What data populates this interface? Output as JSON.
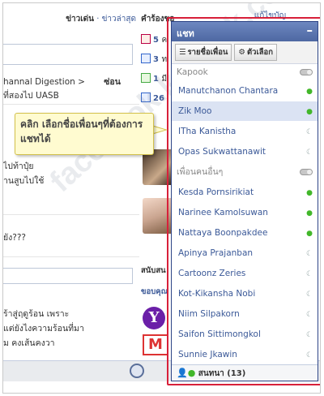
{
  "background": {
    "news_label": "ข่าวเด่น",
    "news_sep": "·",
    "latest_link": "ข่าวล่าสุด",
    "requests_title": "คำร้องขอ",
    "profile_link": "แก้ไขบัญ",
    "line1": "hannal Digestion >",
    "line1_tail": "ซ่อน",
    "line2": "ที่สองไป UASB",
    "line3": "ไปท้าปุ๋ย",
    "line4": "านสูบไปใช้",
    "line5": "ยัง???",
    "line6": "ร้าสู่ฤดูร้อน เพราะ",
    "line7": "แต่ยังไงความร้อนที่มา",
    "line8": "ม คงเส้นคงวา",
    "requests": [
      {
        "count": "5",
        "text": "ค"
      },
      {
        "count": "3",
        "text": "ท"
      },
      {
        "count": "1",
        "text": "มี"
      },
      {
        "count": "26",
        "text": ""
      }
    ],
    "sponsored_label": "สนับสน",
    "thanks_label": "ขอบคุณ"
  },
  "chat": {
    "title": "แชท",
    "minimize": "–",
    "tabs": [
      {
        "icon": "☰",
        "label": "รายชื่อเพื่อน"
      },
      {
        "icon": "⚙",
        "label": "ตัวเลือก"
      }
    ],
    "groups": [
      {
        "name": "Kapook",
        "friends": [
          {
            "name": "Manutchanon Chantara",
            "status": "online"
          },
          {
            "name": "Zik Moo",
            "status": "online",
            "selected": true
          },
          {
            "name": "ITha Kanistha",
            "status": "idle"
          },
          {
            "name": "Opas Sukwattanawit",
            "status": "idle"
          }
        ]
      },
      {
        "name": "เพื่อนคนอื่นๆ",
        "friends": [
          {
            "name": "Kesda Pornsirikiat",
            "status": "online"
          },
          {
            "name": "Narinee Kamolsuwan",
            "status": "online"
          },
          {
            "name": "Nattaya Boonpakdee",
            "status": "online"
          },
          {
            "name": "Apinya Prajanban",
            "status": "idle"
          },
          {
            "name": "Cartoonz Zeries",
            "status": "idle"
          },
          {
            "name": "Kot-Kikansha Nobi",
            "status": "idle"
          },
          {
            "name": "Niim Silpakorn",
            "status": "idle"
          },
          {
            "name": "Saifon Sittimongkol",
            "status": "idle"
          },
          {
            "name": "Sunnie Jkawin",
            "status": "idle"
          }
        ]
      }
    ],
    "footer": "สนทนา (13)"
  },
  "callout": {
    "text": "คลิก เลือกชื่อเพื่อนๆที่ต้องการแชทได้"
  },
  "watermark": "facebook.kapook.com",
  "colors": {
    "facebook_blue": "#3b5998",
    "online": "#42b72a",
    "highlight": "#d8203a",
    "callout_bg": "#fffbd0"
  }
}
